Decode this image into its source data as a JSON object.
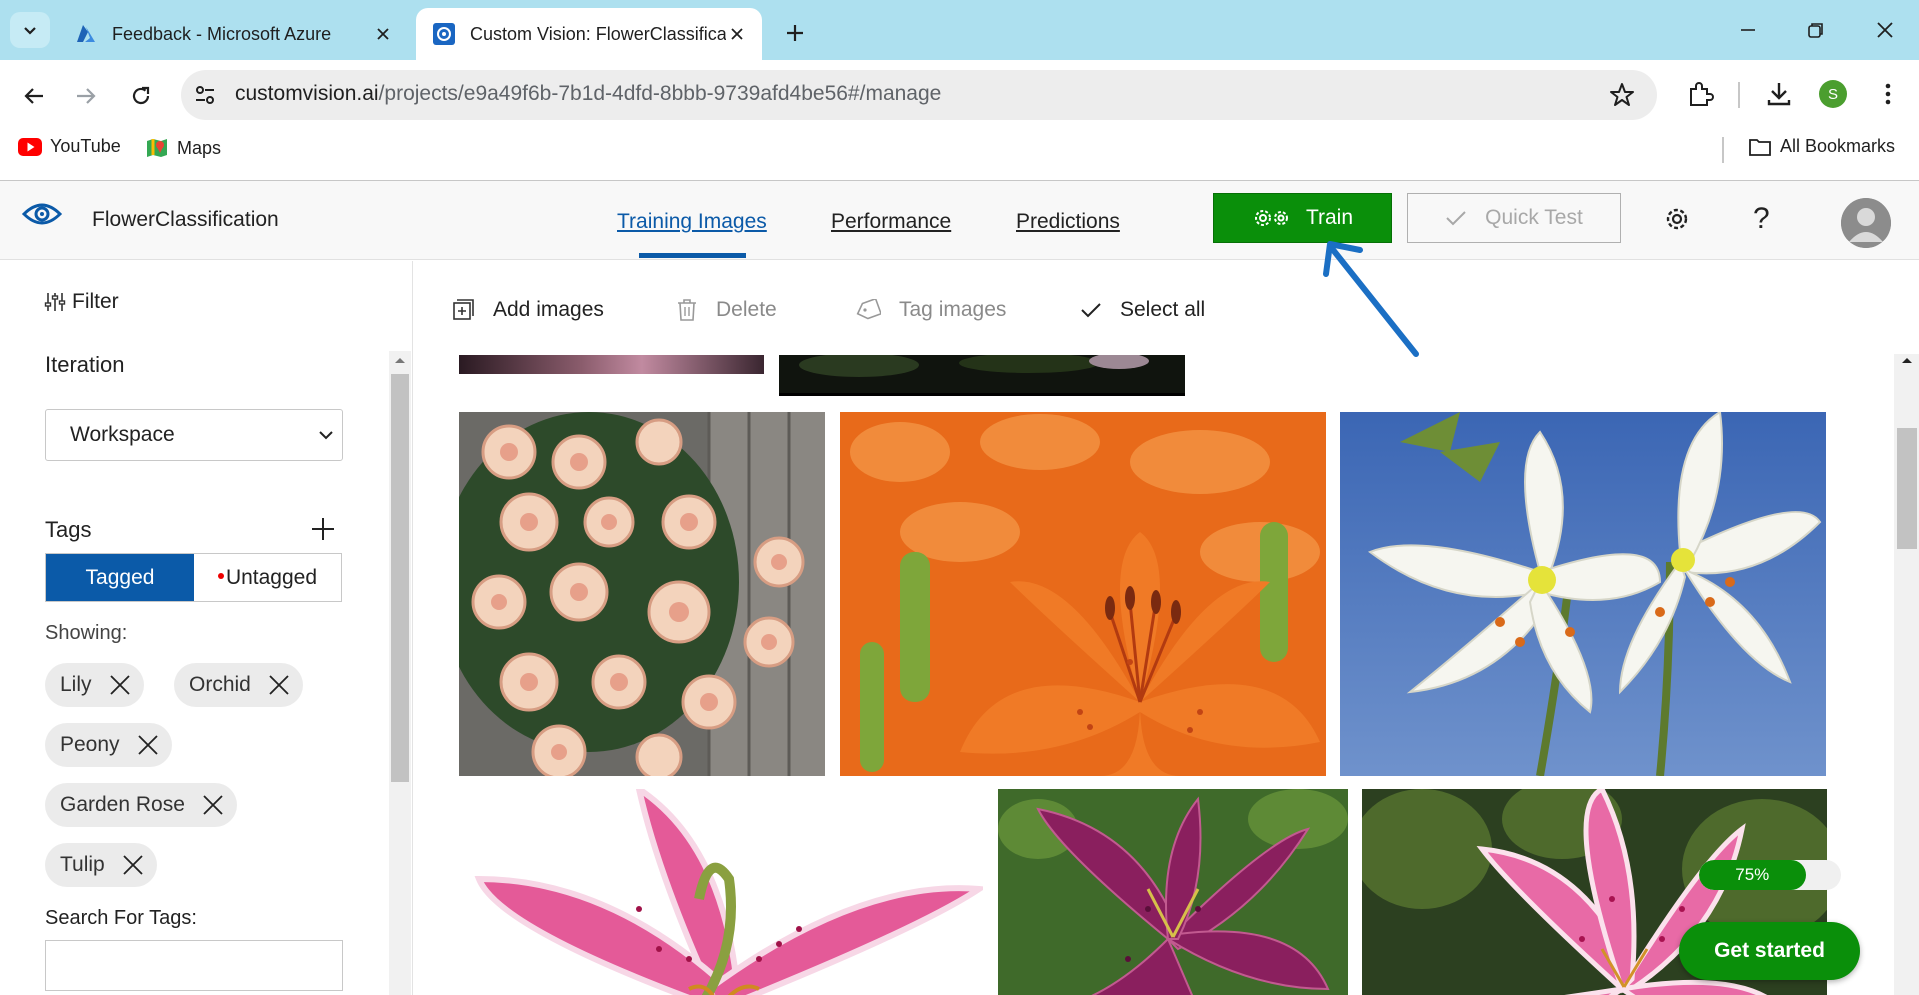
{
  "browser": {
    "tabs": [
      {
        "title": "Feedback - Microsoft Azure"
      },
      {
        "title": "Custom Vision: FlowerClassifica"
      }
    ],
    "url_host": "customvision.ai",
    "url_path": "/projects/e9a49f6b-7b1d-4dfd-8bbb-9739afd4be56#/manage",
    "profile_initial": "S",
    "bookmarks": [
      "YouTube",
      "Maps"
    ],
    "all_bookmarks": "All Bookmarks"
  },
  "app": {
    "project_name": "FlowerClassification",
    "nav_tabs": [
      "Training Images",
      "Performance",
      "Predictions"
    ],
    "active_tab": "Training Images",
    "train_label": "Train",
    "quick_test_label": "Quick Test",
    "help_glyph": "?"
  },
  "sidebar": {
    "filter_label": "Filter",
    "iteration_label": "Iteration",
    "iteration_value": "Workspace",
    "tags_label": "Tags",
    "toggle": {
      "tagged": "Tagged",
      "untagged": "Untagged"
    },
    "showing_label": "Showing:",
    "tag_chips": [
      "Lily",
      "Orchid",
      "Peony",
      "Garden Rose",
      "Tulip"
    ],
    "search_label": "Search For Tags:",
    "search_value": ""
  },
  "actions": {
    "add_images": "Add images",
    "delete": "Delete",
    "tag_images": "Tag images",
    "select_all": "Select all"
  },
  "images": [
    {
      "subject": "peach garden roses"
    },
    {
      "subject": "orange lilies"
    },
    {
      "subject": "white lilies on blue sky"
    },
    {
      "subject": "pink stargazer lily"
    },
    {
      "subject": "purple lilies"
    },
    {
      "subject": "pink lily in garden"
    }
  ],
  "progress": {
    "value": 0.75,
    "label": "75%"
  },
  "get_started_label": "Get started",
  "colors": {
    "accent_blue": "#0b5aa8",
    "train_green": "#0a8f0a",
    "tabbar": "#ade0ef"
  }
}
